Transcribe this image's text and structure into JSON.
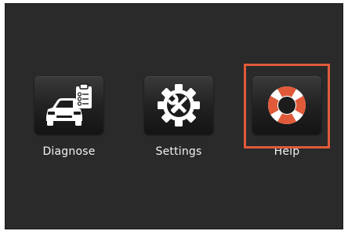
{
  "apps": [
    {
      "label": "Diagnose",
      "icon": "car-diagnostic-icon"
    },
    {
      "label": "Settings",
      "icon": "gear-wrench-screwdriver-icon"
    },
    {
      "label": "Help",
      "icon": "lifebuoy-icon"
    }
  ],
  "selected_app": "Help",
  "colors": {
    "background": "#2a2a2a",
    "tile": "#1f1f1f",
    "icon": "#ffffff",
    "lifebuoy_accent": "#e05a3a",
    "focus_ring": "#e05a3a",
    "label": "#f2f2f2"
  }
}
